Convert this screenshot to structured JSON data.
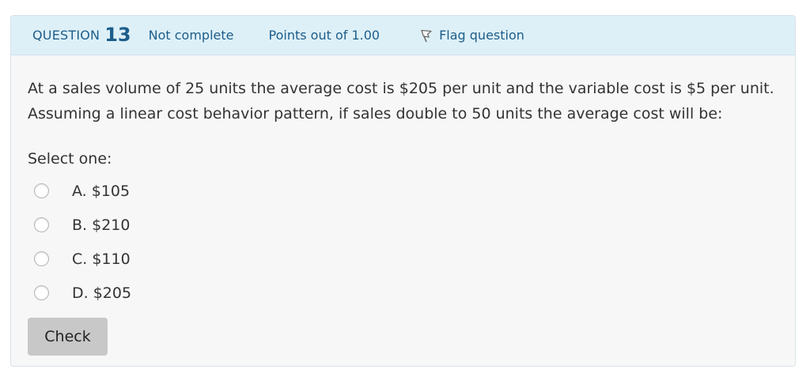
{
  "info": {
    "question_label": "QUESTION",
    "question_number": "13",
    "state": "Not complete",
    "points": "Points out of 1.00",
    "flag_label": "Flag question"
  },
  "question": {
    "text_line1": "At a sales volume of 25 units the average cost is $205 per unit and the variable cost is $5 per unit.",
    "text_line2": "Assuming a linear cost behavior pattern, if sales double to 50 units the average cost will be:",
    "prompt": "Select one:",
    "answers": [
      {
        "label": "A. $105"
      },
      {
        "label": "B. $210"
      },
      {
        "label": "C. $110"
      },
      {
        "label": "D. $205"
      }
    ]
  },
  "actions": {
    "check_label": "Check"
  },
  "colors": {
    "info_bar_bg": "#def0f7",
    "info_text": "#1c5d8a",
    "card_bg": "#f7f7f7",
    "button_bg": "#c8c8c8"
  }
}
